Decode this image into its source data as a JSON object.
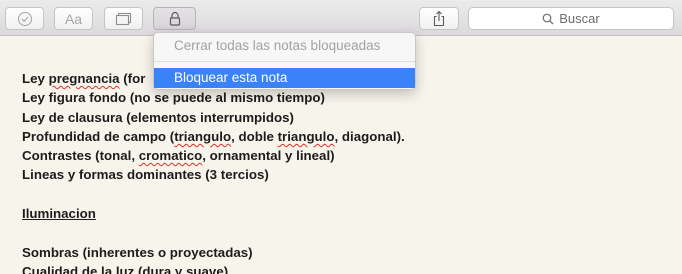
{
  "toolbar": {
    "buttons": [
      {
        "name": "checklist-button",
        "icon": "checkmark-circle-icon"
      },
      {
        "name": "format-button",
        "icon": "text-format-icon",
        "label": "Aa"
      },
      {
        "name": "table-button",
        "icon": "table-icon"
      },
      {
        "name": "lock-button",
        "icon": "lock-icon",
        "active": true
      },
      {
        "name": "share-button",
        "icon": "share-icon"
      }
    ],
    "search": {
      "placeholder": "Buscar",
      "icon": "search-icon"
    }
  },
  "lock_menu": {
    "items": [
      {
        "label": "Cerrar todas las notas bloqueadas",
        "enabled": false
      },
      {
        "label": "Bloquear esta nota",
        "enabled": true,
        "highlighted": true
      }
    ]
  },
  "note": {
    "lines": [
      {
        "parts": [
          "Ley ",
          "pregnancia",
          " (for"
        ]
      },
      {
        "text": "Ley figura fondo (no se puede al mismo tiempo)"
      },
      {
        "text": "Ley de clausura (elementos interrumpidos)"
      },
      {
        "parts": [
          "Profundidad de campo (",
          "triangulo",
          ", doble ",
          "triangulo",
          ", diagonal)."
        ]
      },
      {
        "parts": [
          "Contrastes (tonal, ",
          "cromatico",
          ", ornamental y lineal)"
        ]
      },
      {
        "text": "Lineas y formas dominantes (3 tercios)"
      },
      {
        "text": ""
      },
      {
        "text": "Iluminacion",
        "underline": true
      },
      {
        "text": ""
      },
      {
        "text": "Sombras (inherentes o proyectadas)"
      },
      {
        "text": "Cualidad de la luz (dura y suave)"
      }
    ]
  },
  "colors": {
    "page_background": "#f7f4ec",
    "menu_highlight": "#3a82f7",
    "spellcheck_underline": "#d9332b",
    "text": "#1c1c1c"
  }
}
